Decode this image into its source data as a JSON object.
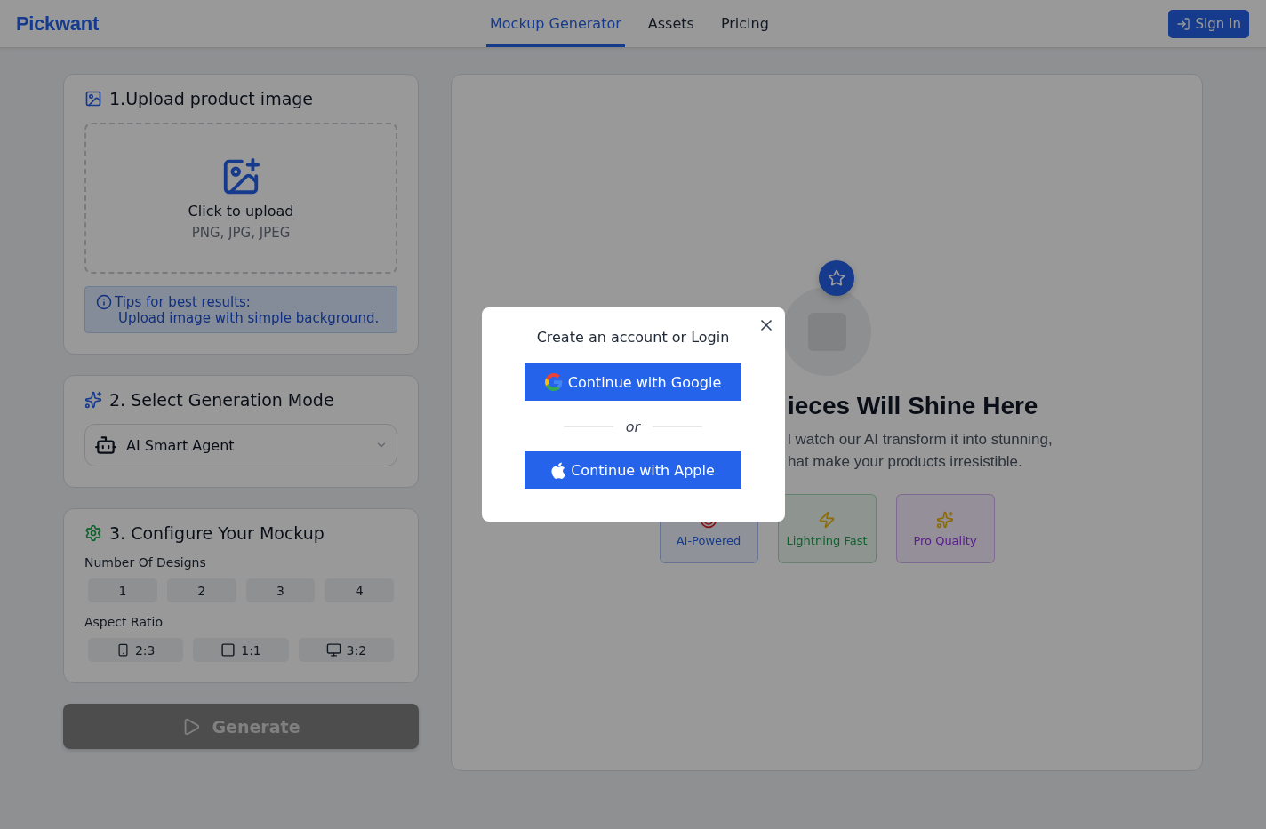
{
  "header": {
    "logo": "Pickwant",
    "nav": [
      {
        "label": "Mockup Generator",
        "selected": true
      },
      {
        "label": "Assets",
        "selected": false
      },
      {
        "label": "Pricing",
        "selected": false
      }
    ],
    "sign_in": "Sign In"
  },
  "upload": {
    "title": "1.Upload product image",
    "drop_label": "Click to upload",
    "formats": "PNG, JPG, JPEG",
    "tip_title": "Tips for best results:",
    "tip_text": "Upload image with simple background."
  },
  "mode": {
    "title": "2. Select Generation Mode",
    "value": "AI Smart Agent"
  },
  "configure": {
    "title": "3. Configure Your Mockup",
    "designs_label": "Number Of Designs",
    "designs": [
      {
        "label": "1",
        "selected": false
      },
      {
        "label": "2",
        "selected": false
      },
      {
        "label": "3",
        "selected": false
      },
      {
        "label": "4",
        "selected": false
      }
    ],
    "ratio_label": "Aspect Ratio",
    "ratios": [
      {
        "label": "2:3",
        "kind": "portrait",
        "selected": false
      },
      {
        "label": "1:1",
        "kind": "square",
        "selected": false
      },
      {
        "label": "3:2",
        "kind": "landscape",
        "selected": false
      }
    ]
  },
  "generate": {
    "label": "Generate",
    "disabled": true
  },
  "preview": {
    "heading": "ieces Will Shine Here",
    "lines": [
      "l watch our AI transform it into stunning,",
      "hat make your products irresistible."
    ],
    "features": [
      {
        "label": "AI-Powered",
        "kind": "target"
      },
      {
        "label": "Lightning Fast",
        "kind": "bolt"
      },
      {
        "label": "Pro Quality",
        "kind": "sparkle"
      }
    ]
  },
  "modal": {
    "title": "Create an account or Login",
    "google": "Continue with Google",
    "divider": "or",
    "apple": "Continue with Apple"
  }
}
